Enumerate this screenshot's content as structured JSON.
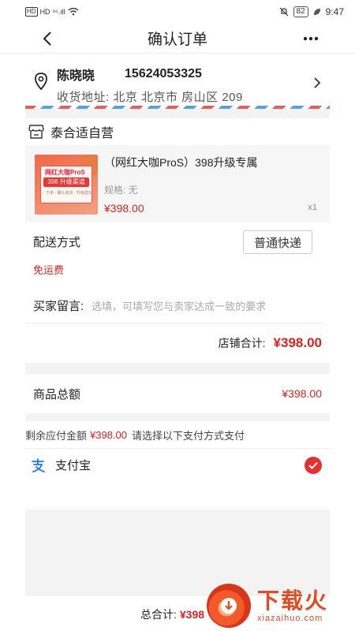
{
  "status_bar": {
    "left": "HD ⁴⁶.ıll",
    "battery": "82",
    "time": "9:47"
  },
  "nav": {
    "title": "确认订单",
    "back_icon": "chevron-left-icon",
    "more_icon": "more-dots-icon"
  },
  "address": {
    "name": "陈晓晓",
    "phone": "15624053325",
    "detail": "收货地址: 北京 北京市 房山区 209"
  },
  "shop": {
    "name": "泰合适自营"
  },
  "product": {
    "title": "（网红大咖ProS）398升级专属",
    "spec": "规格: 无",
    "price": "¥398.00",
    "qty": "x1",
    "thumb_line1": "网红大咖ProS",
    "thumb_line2": "398 升级渠道",
    "thumb_line3": "下单 · 确认收货 · 升级成功"
  },
  "delivery": {
    "label": "配送方式",
    "method": "普通快递",
    "free_shipping": "免运费"
  },
  "message": {
    "label": "买家留言:",
    "placeholder": "选填，可填写您与卖家达成一致的要求"
  },
  "shop_total": {
    "label": "店铺合计:",
    "value": "¥398.00"
  },
  "goods_total": {
    "label": "商品总额",
    "value": "¥398.00"
  },
  "payment": {
    "remaining_label": "剩余应付金额",
    "remaining_value": "¥398.00",
    "instruction": "请选择以下支付方式支付",
    "method": "支付宝",
    "selected": true
  },
  "bottom": {
    "total_label": "总合计:",
    "total_value": "¥398"
  },
  "watermark": {
    "title": "下载火",
    "url": "xiazaihuo.com"
  },
  "colors": {
    "accent_red": "#e02020",
    "check_red": "#e53030",
    "alipay_blue": "#1677ff"
  }
}
